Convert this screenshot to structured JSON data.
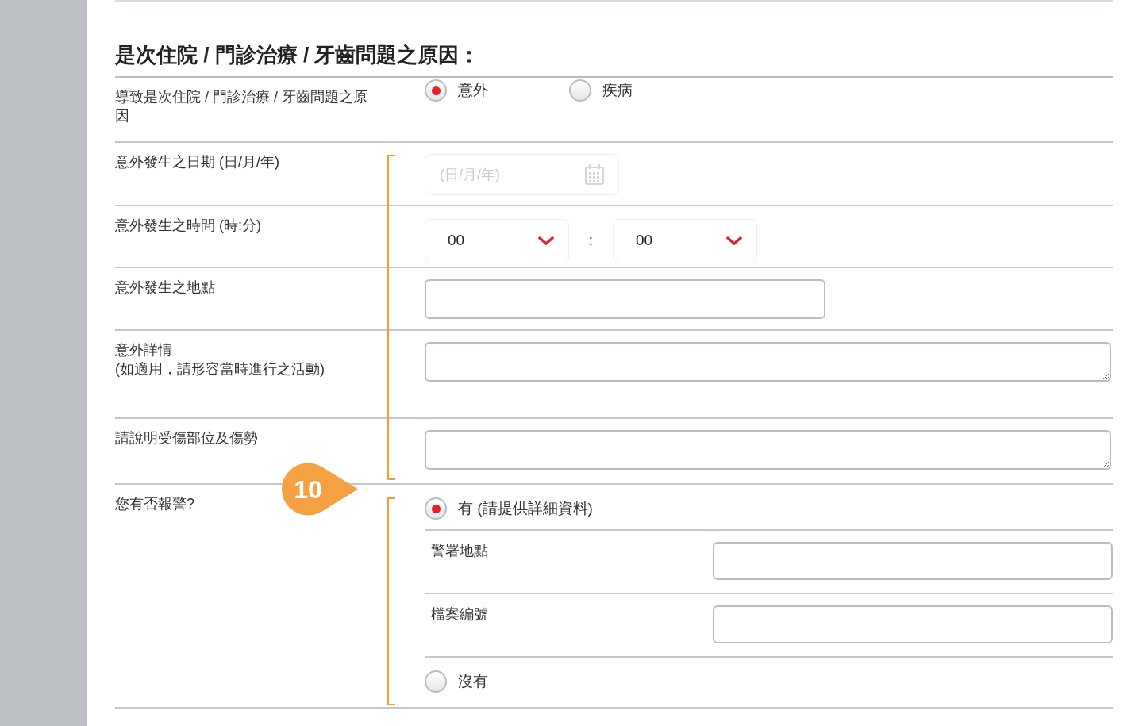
{
  "title": "是次住院 / 門診治療 / 牙齒問題之原因：",
  "rows": [
    {
      "kind": "radio",
      "label": "導致是次住院 / 門診治療 / 牙齒問題之原因",
      "options": [
        {
          "label": "意外",
          "selected": true
        },
        {
          "label": "疾病",
          "selected": false
        }
      ]
    },
    {
      "kind": "date",
      "label": "意外發生之日期 (日/月/年)",
      "placeholder": "(日/月/年)"
    },
    {
      "kind": "time",
      "label": "意外發生之時間 (時:分)",
      "hour": "00",
      "separator": ":",
      "minute": "00"
    },
    {
      "kind": "text",
      "label": "意外發生之地點"
    },
    {
      "kind": "textarea",
      "label": "意外詳情\n(如適用，請形容當時進行之活動)"
    },
    {
      "kind": "textarea",
      "label": "請說明受傷部位及傷勢"
    },
    {
      "kind": "radio-detail",
      "label": "您有否報警?",
      "options": [
        {
          "label": "有 (請提供詳細資料)",
          "selected": true,
          "fields": [
            "警署地點",
            "檔案編號"
          ]
        },
        {
          "label": "沒有",
          "selected": false
        }
      ]
    }
  ],
  "annotation": {
    "number": "10"
  }
}
